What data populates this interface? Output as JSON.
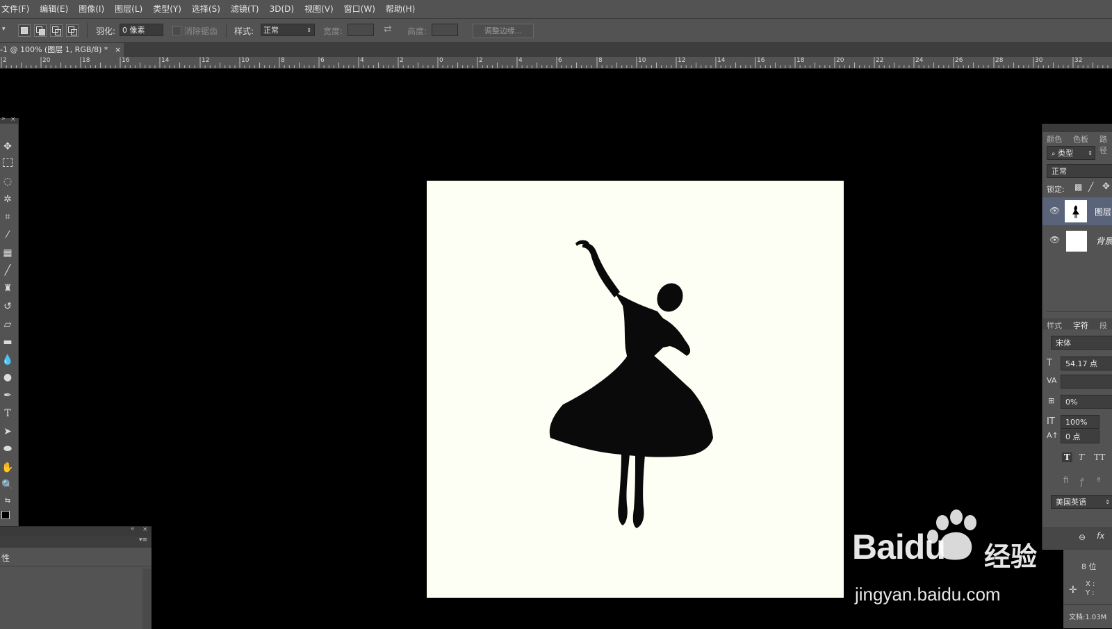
{
  "menu": [
    "文件(F)",
    "编辑(E)",
    "图像(I)",
    "图层(L)",
    "类型(Y)",
    "选择(S)",
    "滤镜(T)",
    "3D(D)",
    "视图(V)",
    "窗口(W)",
    "帮助(H)"
  ],
  "options": {
    "feather_label": "羽化:",
    "feather_value": "0 像素",
    "antialias_label": "消除锯齿",
    "style_label": "样式:",
    "style_value": "正常",
    "width_label": "宽度:",
    "height_label": "高度:",
    "refine_button": "调整边缘..."
  },
  "doc_tab": {
    "title": "-1 @ 100% (图层 1, RGB/8) *",
    "close": "×"
  },
  "ruler_ticks": [
    "2",
    "20",
    "18",
    "16",
    "14",
    "12",
    "10",
    "8",
    "6",
    "4",
    "2",
    "0",
    "2",
    "4",
    "6",
    "8",
    "10",
    "12",
    "14",
    "16",
    "18",
    "20",
    "22",
    "24",
    "26",
    "28",
    "30",
    "32",
    "34"
  ],
  "layers_panel": {
    "tabs": [
      "颜色",
      "色板",
      "路径"
    ],
    "filter_kind": "类型",
    "blend_mode": "正常",
    "lock_label": "锁定:",
    "layers": [
      {
        "name": "图层",
        "visible": true
      },
      {
        "name": "背景",
        "visible": true
      }
    ]
  },
  "character_panel": {
    "tabs": [
      "样式",
      "字符",
      "段"
    ],
    "font": "宋体",
    "font_size": "54.17 点",
    "tracking": "0%",
    "vertical_scale": "100%",
    "baseline": "0 点",
    "language": "美国英语"
  },
  "status": {
    "bits": "8 位",
    "x_label": "X :",
    "y_label": "Y :",
    "doc_size": "文档:1.03M"
  },
  "bottom_left_panel": {
    "label": "性"
  },
  "watermark": {
    "brand": "Baidu",
    "sub": "经验",
    "url": "jingyan.baidu.com"
  },
  "colors": {
    "ui_gray": "#535353",
    "canvas": "#fdfef4",
    "silhouette": "#0a0a0a"
  }
}
